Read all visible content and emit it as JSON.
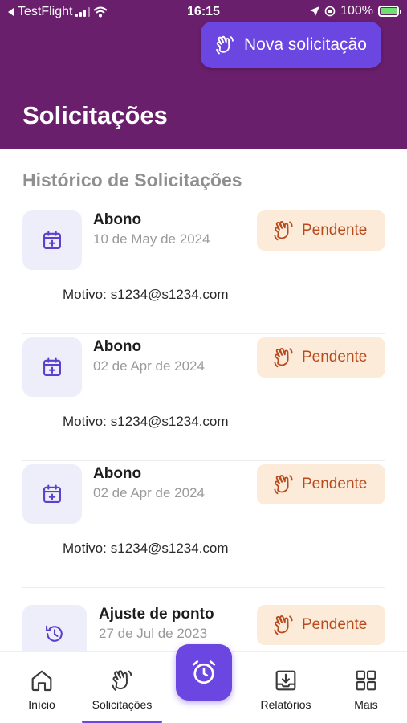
{
  "status_bar": {
    "carrier": "TestFlight",
    "time": "16:15",
    "battery": "100%"
  },
  "header": {
    "new_request_label": "Nova solicitação",
    "title": "Solicitações"
  },
  "history": {
    "title": "Histórico de Solicitações",
    "reason_label": "Motivo:",
    "items": [
      {
        "type": "Abono",
        "date": "10 de May de 2024",
        "status": "Pendente",
        "reason": "s1234@s1234.com",
        "icon": "calendar-plus-icon"
      },
      {
        "type": "Abono",
        "date": "02 de Apr de 2024",
        "status": "Pendente",
        "reason": "s1234@s1234.com",
        "icon": "calendar-plus-icon"
      },
      {
        "type": "Abono",
        "date": "02 de Apr de 2024",
        "status": "Pendente",
        "reason": "s1234@s1234.com",
        "icon": "calendar-plus-icon"
      },
      {
        "type": "Ajuste de ponto",
        "date": "27 de Jul de 2023",
        "status": "Pendente",
        "icon": "history-icon"
      }
    ]
  },
  "tabbar": {
    "active": "Solicitações",
    "tabs": [
      {
        "label": "Início",
        "icon": "home-icon"
      },
      {
        "label": "Solicitações",
        "icon": "hand-wave-icon"
      },
      {
        "label": "Relatórios",
        "icon": "download-tray-icon"
      },
      {
        "label": "Mais",
        "icon": "grid-icon"
      }
    ],
    "fab_icon": "alarm-clock-icon"
  },
  "colors": {
    "header_bg": "#6a1f6d",
    "accent": "#6b46e0",
    "badge_bg": "#fcebd8",
    "badge_text": "#b84a1e",
    "icon_box_bg": "#eeeefb"
  }
}
